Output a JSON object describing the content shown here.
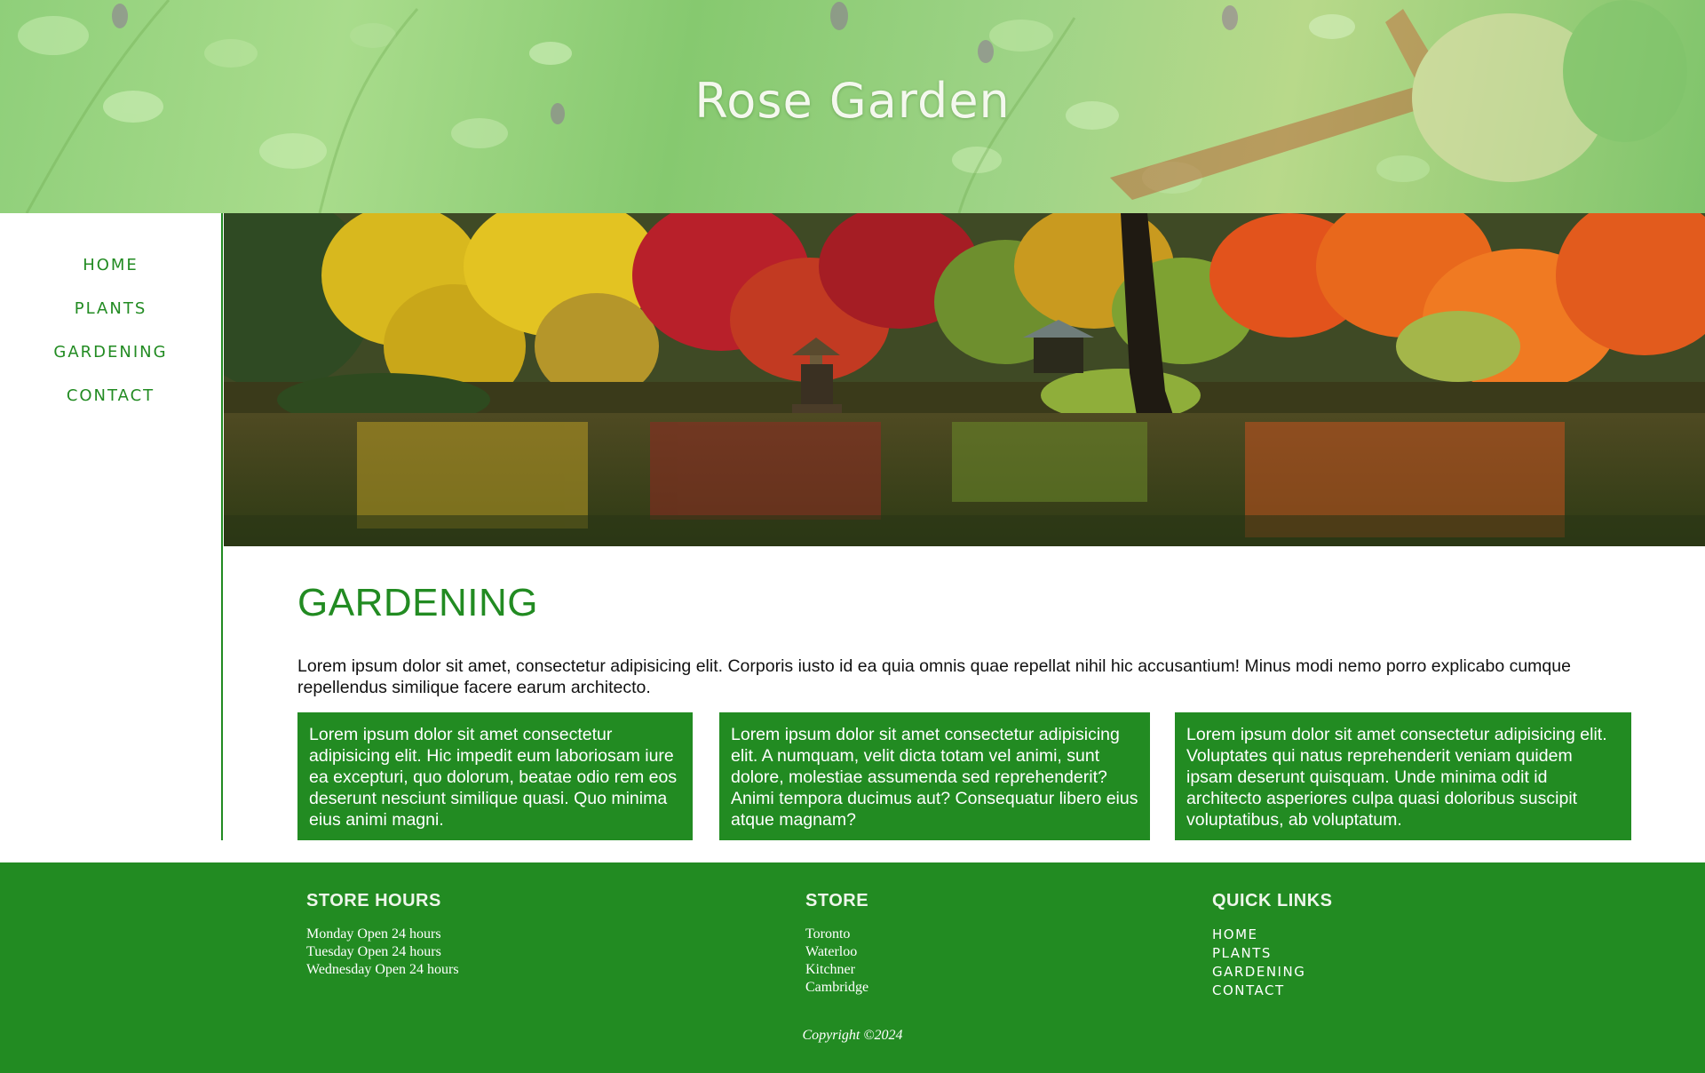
{
  "header": {
    "site_title": "Rose Garden"
  },
  "nav": {
    "items": [
      {
        "label": "HOME"
      },
      {
        "label": "PLANTS"
      },
      {
        "label": "GARDENING"
      },
      {
        "label": "CONTACT"
      }
    ]
  },
  "main": {
    "title": "GARDENING",
    "intro": "Lorem ipsum dolor sit amet, consectetur adipisicing elit. Corporis iusto id ea quia omnis quae repellat nihil hic accusantium! Minus modi nemo porro explicabo cumque repellendus similique facere earum architecto.",
    "cards": [
      {
        "text": "Lorem ipsum dolor sit amet consectetur adipisicing elit. Hic impedit eum laboriosam iure ea excepturi, quo dolorum, beatae odio rem eos deserunt nesciunt similique quasi. Quo minima eius animi magni."
      },
      {
        "text": "Lorem ipsum dolor sit amet consectetur adipisicing elit. A numquam, velit dicta totam vel animi, sunt dolore, molestiae assumenda sed reprehenderit? Animi tempora ducimus aut? Consequatur libero eius atque magnam?"
      },
      {
        "text": "Lorem ipsum dolor sit amet consectetur adipisicing elit. Voluptates qui natus reprehenderit veniam quidem ipsam deserunt quisquam. Unde minima odit id architecto asperiores culpa quasi doloribus suscipit voluptatibus, ab voluptatum."
      }
    ]
  },
  "footer": {
    "store_hours": {
      "title": "STORE HOURS",
      "items": [
        "Monday Open 24 hours",
        "Tuesday Open 24 hours",
        "Wednesday Open 24 hours"
      ]
    },
    "store": {
      "title": "STORE",
      "items": [
        "Toronto",
        "Waterloo",
        "Kitchner",
        "Cambridge"
      ]
    },
    "quick_links": {
      "title": "QUICK LINKS",
      "items": [
        "HOME",
        "PLANTS",
        "GARDENING",
        "CONTACT"
      ]
    },
    "copyright": "Copyright ©2024"
  },
  "colors": {
    "accent": "#228b22",
    "header_tint": "#9fd487",
    "text": "#111111",
    "on_accent": "#ffffff"
  }
}
